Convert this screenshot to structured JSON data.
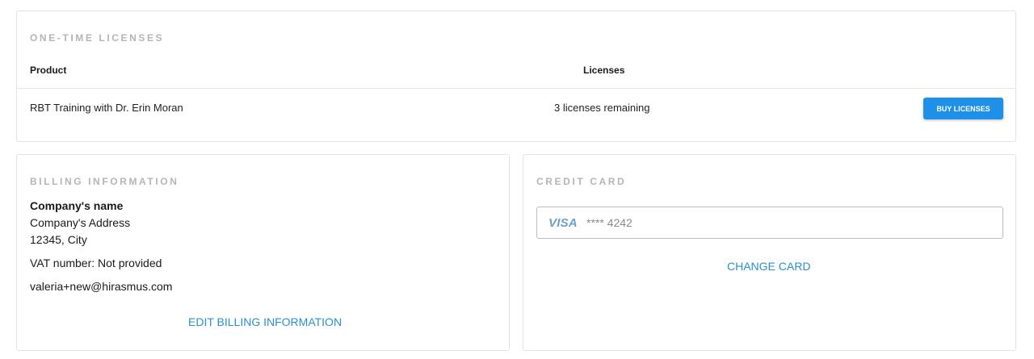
{
  "licenses": {
    "title": "ONE-TIME LICENSES",
    "columns": {
      "product": "Product",
      "licenses": "Licenses"
    },
    "rows": [
      {
        "product": "RBT Training with Dr. Erin Moran",
        "licenses": "3 licenses remaining",
        "action": "BUY LICENSES"
      }
    ]
  },
  "billing": {
    "title": "BILLING INFORMATION",
    "company_name": "Company's name",
    "address": "Company's Address",
    "city": "12345, City",
    "vat": "VAT number: Not provided",
    "email": "valeria+new@hirasmus.com",
    "edit_label": "EDIT BILLING INFORMATION"
  },
  "credit": {
    "title": "CREDIT CARD",
    "brand": "VISA",
    "brand_icon": "visa-icon",
    "number": "**** 4242",
    "change_label": "CHANGE CARD"
  },
  "colors": {
    "accent": "#1e90e8",
    "link": "#2a8fd6",
    "muted_title": "#b5b5b5"
  }
}
